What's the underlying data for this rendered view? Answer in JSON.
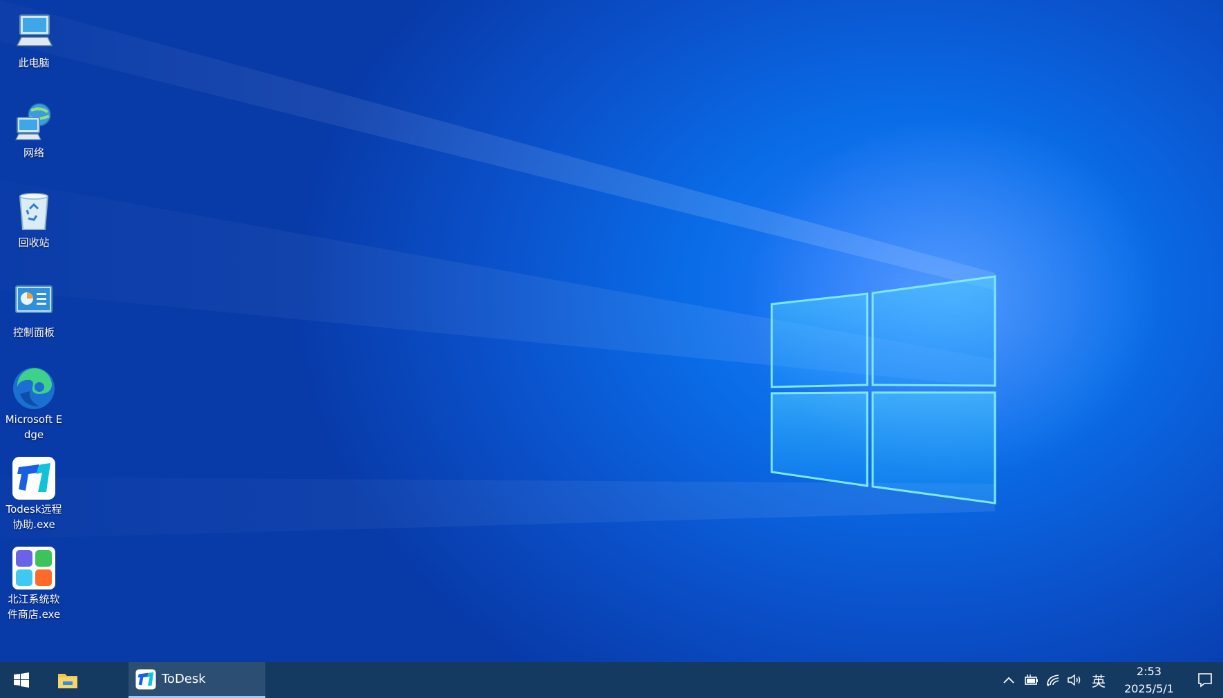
{
  "desktop": {
    "icons": [
      {
        "name": "此电脑",
        "icon": "this-pc-icon"
      },
      {
        "name": "网络",
        "icon": "network-icon"
      },
      {
        "name": "回收站",
        "icon": "recycle-bin-icon"
      },
      {
        "name": "控制面板",
        "icon": "control-panel-icon"
      },
      {
        "name": "Microsoft Edge",
        "icon": "edge-icon"
      },
      {
        "name": "Todesk远程协助.exe",
        "icon": "todesk-icon"
      },
      {
        "name": "北江系统软件商店.exe",
        "icon": "app-store-icon"
      }
    ]
  },
  "taskbar": {
    "running_app": {
      "label": "ToDesk",
      "icon": "todesk-icon"
    },
    "tray": {
      "ime": "英",
      "time": "2:53",
      "date": "2025/5/1"
    }
  },
  "colors": {
    "taskbar": "#153a62",
    "wallpaper_accent": "#0a6de8"
  }
}
